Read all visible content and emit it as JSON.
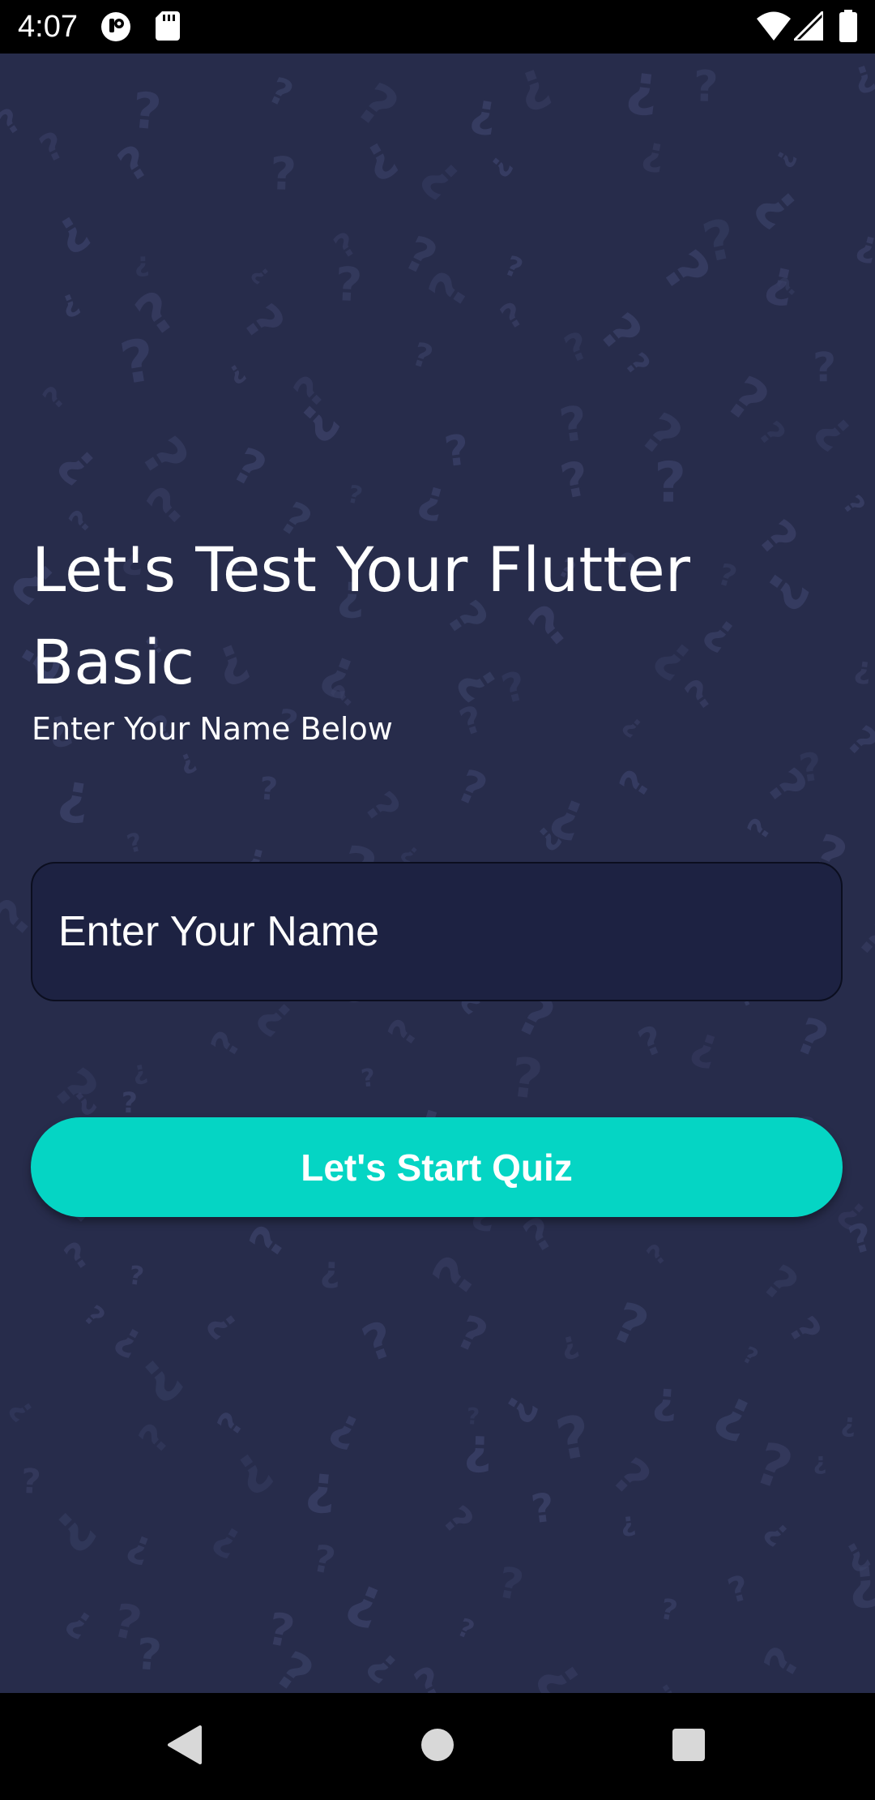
{
  "status_bar": {
    "time": "4:07",
    "icons": [
      "notification-app-icon",
      "sd-card-icon",
      "wifi-icon",
      "signal-icon",
      "battery-icon"
    ]
  },
  "main": {
    "title": "Let's Test Your Flutter Basic",
    "subtitle": "Enter Your Name Below",
    "name_input": {
      "placeholder": "Enter Your Name",
      "value": ""
    },
    "start_button_label": "Let's Start Quiz"
  },
  "nav_bar": {
    "buttons": [
      "back-icon",
      "home-icon",
      "recents-icon"
    ]
  },
  "colors": {
    "background": "#272c4b",
    "input_background": "#1d2242",
    "accent": "#05d5c4",
    "text": "#ffffff"
  }
}
